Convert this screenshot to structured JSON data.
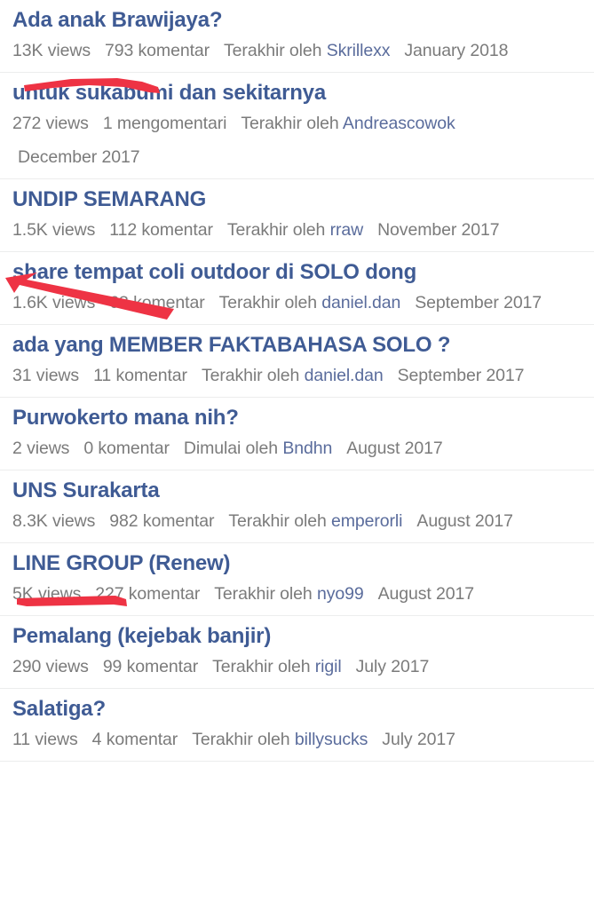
{
  "page": {
    "type": "forum-thread-list",
    "title_color": "#3f5b94",
    "meta_color": "#7b7b7b",
    "author_link_color": "#5a6c9c",
    "separator_color": "#eceded",
    "background": "#ffffff",
    "annotation_color": "#ee3344"
  },
  "threads": [
    {
      "title": "Ada anak Brawijaya?",
      "views": "13K views",
      "comments": "793 komentar",
      "byline_label": "Terakhir oleh",
      "author": "Skrillexx",
      "date": "January 2018",
      "wrap": false
    },
    {
      "title": "untuk sukabumi dan sekitarnya",
      "views": "272 views",
      "comments": "1 mengomentari",
      "byline_label": "Terakhir oleh",
      "author": "Andreascowok",
      "date": "December 2017",
      "wrap": true
    },
    {
      "title": "UNDIP SEMARANG",
      "views": "1.5K views",
      "comments": "112 komentar",
      "byline_label": "Terakhir oleh",
      "author": "rraw",
      "date": "November 2017",
      "wrap": false
    },
    {
      "title": "share tempat coli outdoor di SOLO dong",
      "views": "1.6K views",
      "comments": "63 komentar",
      "byline_label": "Terakhir oleh",
      "author": "daniel.dan",
      "date": "September 2017",
      "wrap": false
    },
    {
      "title": "ada yang MEMBER FAKTABAHASA SOLO ?",
      "views": "31 views",
      "comments": "11 komentar",
      "byline_label": "Terakhir oleh",
      "author": "daniel.dan",
      "date": "September 2017",
      "wrap": false
    },
    {
      "title": "Purwokerto mana nih?",
      "views": "2 views",
      "comments": "0 komentar",
      "byline_label": "Dimulai oleh",
      "author": "Bndhn",
      "date": "August 2017",
      "wrap": false
    },
    {
      "title": "UNS Surakarta",
      "views": "8.3K views",
      "comments": "982 komentar",
      "byline_label": "Terakhir oleh",
      "author": "emperorli",
      "date": "August 2017",
      "wrap": false
    },
    {
      "title": "LINE GROUP (Renew)",
      "views": "5K views",
      "comments": "227 komentar",
      "byline_label": "Terakhir oleh",
      "author": "nyo99",
      "date": "August 2017",
      "wrap": false
    },
    {
      "title": "Pemalang (kejebak banjir)",
      "views": "290 views",
      "comments": "99 komentar",
      "byline_label": "Terakhir oleh",
      "author": "rigil",
      "date": "July 2017",
      "wrap": false
    },
    {
      "title": "Salatiga?",
      "views": "11 views",
      "comments": "4 komentar",
      "byline_label": "Terakhir oleh",
      "author": "billysucks",
      "date": "July 2017",
      "wrap": false
    }
  ],
  "annotations": [
    {
      "kind": "underline-stroke",
      "target": "Ada anak Brawijaya? views row"
    },
    {
      "kind": "arrow-up-left",
      "target": "UNDIP SEMARANG views row"
    },
    {
      "kind": "underline-stroke",
      "target": "UNS Surakarta title"
    }
  ]
}
